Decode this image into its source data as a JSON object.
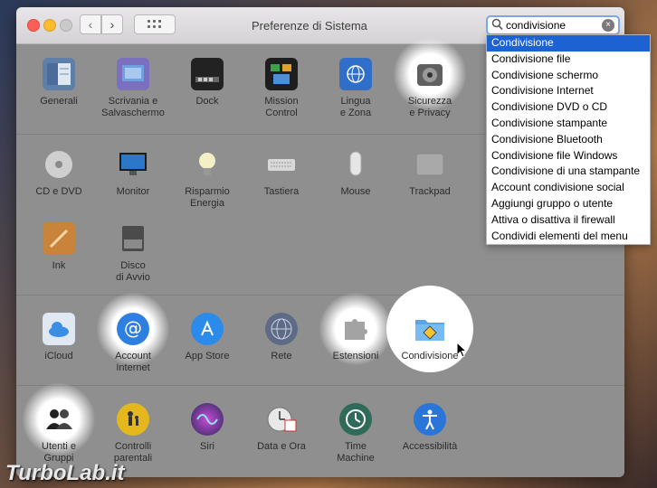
{
  "window": {
    "title": "Preferenze di Sistema",
    "nav": {
      "back": "‹",
      "forward": "›"
    }
  },
  "search": {
    "value": "condivisione",
    "clear_glyph": "×"
  },
  "sections": [
    {
      "panes": [
        {
          "label": "Generali",
          "icon": "general-icon"
        },
        {
          "label": "Scrivania e\nSalvaschermo",
          "icon": "desktop-icon"
        },
        {
          "label": "Dock",
          "icon": "dock-icon"
        },
        {
          "label": "Mission\nControl",
          "icon": "mission-control-icon"
        },
        {
          "label": "Lingua\ne Zona",
          "icon": "flag-icon"
        },
        {
          "label": "Sicurezza\ne Privacy",
          "icon": "security-icon"
        }
      ]
    },
    {
      "panes": [
        {
          "label": "CD e DVD",
          "icon": "cd-icon"
        },
        {
          "label": "Monitor",
          "icon": "monitor-icon"
        },
        {
          "label": "Risparmio\nEnergia",
          "icon": "bulb-icon"
        },
        {
          "label": "Tastiera",
          "icon": "keyboard-icon"
        },
        {
          "label": "Mouse",
          "icon": "mouse-icon"
        },
        {
          "label": "Trackpad",
          "icon": "trackpad-icon"
        },
        {
          "label": "Ink",
          "icon": "ink-icon"
        },
        {
          "label": "Disco\ndi Avvio",
          "icon": "disk-icon"
        }
      ]
    },
    {
      "panes": [
        {
          "label": "iCloud",
          "icon": "cloud-icon"
        },
        {
          "label": "Account\nInternet",
          "icon": "at-icon"
        },
        {
          "label": "App Store",
          "icon": "app-store-icon"
        },
        {
          "label": "Rete",
          "icon": "network-icon"
        },
        {
          "label": "Estensioni",
          "icon": "puzzle-icon"
        },
        {
          "label": "Condivisione",
          "icon": "sharing-folder-icon"
        }
      ]
    },
    {
      "panes": [
        {
          "label": "Utenti e\nGruppi",
          "icon": "users-icon"
        },
        {
          "label": "Controlli\nparentali",
          "icon": "parental-icon"
        },
        {
          "label": "Siri",
          "icon": "siri-icon"
        },
        {
          "label": "Data e Ora",
          "icon": "clock-calendar-icon"
        },
        {
          "label": "Time\nMachine",
          "icon": "time-machine-icon"
        },
        {
          "label": "Accessibilità",
          "icon": "accessibility-icon"
        }
      ]
    }
  ],
  "dropdown": {
    "items": [
      "Condivisione",
      "Condivisione file",
      "Condivisione schermo",
      "Condivisione Internet",
      "Condivisione DVD o CD",
      "Condivisione stampante",
      "Condivisione Bluetooth",
      "Condivisione file Windows",
      "Condivisione di una stampante",
      "Account condivisione social",
      "Aggiungi gruppo o utente",
      "Attiva o disattiva il firewall",
      "Condividi elementi del menu"
    ],
    "selected_index": 0
  },
  "watermark": "TurboLab.it"
}
